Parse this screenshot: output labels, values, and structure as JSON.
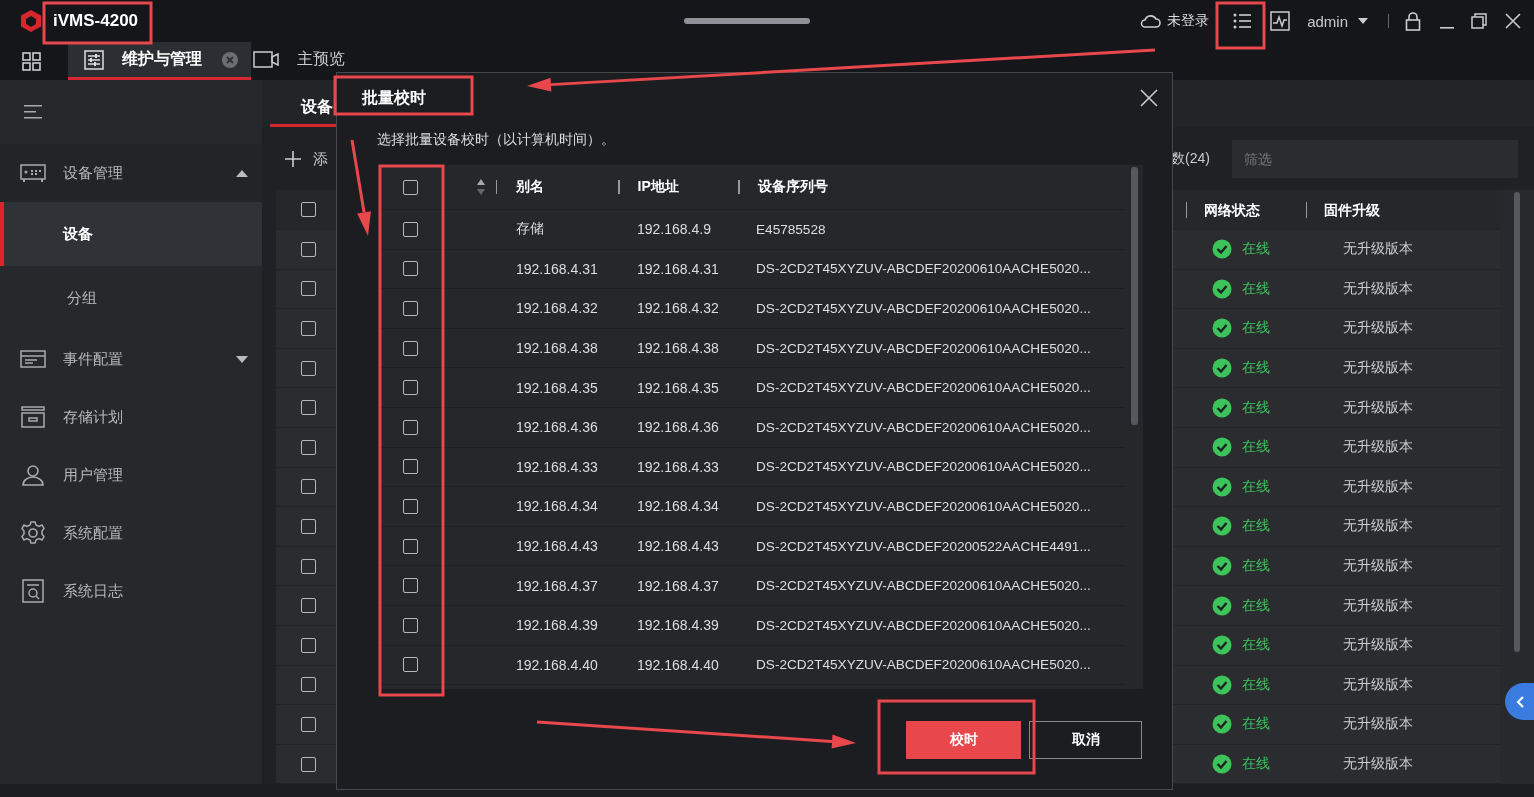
{
  "titlebar": {
    "app_name": "iVMS-4200",
    "login_status": "未登录",
    "user": "admin"
  },
  "tabs": [
    {
      "label": "维护与管理",
      "selected": true,
      "closable": true
    },
    {
      "label": "主预览",
      "selected": false,
      "closable": false
    }
  ],
  "sidebar": {
    "items": [
      {
        "label": "设备管理",
        "kind": "group",
        "expanded": true,
        "children": [
          {
            "label": "设备",
            "selected": true
          },
          {
            "label": "分组",
            "selected": false
          }
        ]
      },
      {
        "label": "事件配置",
        "kind": "group",
        "expanded": false
      },
      {
        "label": "存储计划",
        "kind": "item"
      },
      {
        "label": "用户管理",
        "kind": "item"
      },
      {
        "label": "系统配置",
        "kind": "item"
      },
      {
        "label": "系统日志",
        "kind": "item"
      }
    ]
  },
  "content": {
    "tabs": [
      {
        "label": "设备",
        "selected": true
      }
    ],
    "add_label": "添",
    "count_label": "数(24)",
    "filter": {
      "placeholder": "筛选"
    },
    "table": {
      "header_checked": false,
      "columns": [
        "网络状态",
        "固件升级"
      ],
      "rows": [
        {
          "checked": false,
          "online": true,
          "status": "在线",
          "firmware": "无升级版本"
        },
        {
          "checked": false,
          "online": true,
          "status": "在线",
          "firmware": "无升级版本"
        },
        {
          "checked": false,
          "online": true,
          "status": "在线",
          "firmware": "无升级版本"
        },
        {
          "checked": false,
          "online": true,
          "status": "在线",
          "firmware": "无升级版本"
        },
        {
          "checked": false,
          "online": true,
          "status": "在线",
          "firmware": "无升级版本"
        },
        {
          "checked": false,
          "online": true,
          "status": "在线",
          "firmware": "无升级版本"
        },
        {
          "checked": false,
          "online": true,
          "status": "在线",
          "firmware": "无升级版本"
        },
        {
          "checked": false,
          "online": true,
          "status": "在线",
          "firmware": "无升级版本"
        },
        {
          "checked": false,
          "online": true,
          "status": "在线",
          "firmware": "无升级版本"
        },
        {
          "checked": false,
          "online": true,
          "status": "在线",
          "firmware": "无升级版本"
        },
        {
          "checked": false,
          "online": true,
          "status": "在线",
          "firmware": "无升级版本"
        },
        {
          "checked": false,
          "online": true,
          "status": "在线",
          "firmware": "无升级版本"
        },
        {
          "checked": false,
          "online": true,
          "status": "在线",
          "firmware": "无升级版本"
        },
        {
          "checked": false,
          "online": true,
          "status": "在线",
          "firmware": "无升级版本"
        }
      ]
    }
  },
  "dialog": {
    "title": "批量校时",
    "instruction": "选择批量设备校时（以计算机时间）。",
    "table": {
      "header_checked": false,
      "columns": [
        "别名",
        "IP地址",
        "设备序列号"
      ],
      "rows": [
        {
          "checked": false,
          "alias": "存储",
          "ip": "192.168.4.9",
          "serial": "E45785528"
        },
        {
          "checked": false,
          "alias": "192.168.4.31",
          "ip": "192.168.4.31",
          "serial": "DS-2CD2T45XYZUV-ABCDEF20200610AACHE5020..."
        },
        {
          "checked": false,
          "alias": "192.168.4.32",
          "ip": "192.168.4.32",
          "serial": "DS-2CD2T45XYZUV-ABCDEF20200610AACHE5020..."
        },
        {
          "checked": false,
          "alias": "192.168.4.38",
          "ip": "192.168.4.38",
          "serial": "DS-2CD2T45XYZUV-ABCDEF20200610AACHE5020..."
        },
        {
          "checked": false,
          "alias": "192.168.4.35",
          "ip": "192.168.4.35",
          "serial": "DS-2CD2T45XYZUV-ABCDEF20200610AACHE5020..."
        },
        {
          "checked": false,
          "alias": "192.168.4.36",
          "ip": "192.168.4.36",
          "serial": "DS-2CD2T45XYZUV-ABCDEF20200610AACHE5020..."
        },
        {
          "checked": false,
          "alias": "192.168.4.33",
          "ip": "192.168.4.33",
          "serial": "DS-2CD2T45XYZUV-ABCDEF20200610AACHE5020..."
        },
        {
          "checked": false,
          "alias": "192.168.4.34",
          "ip": "192.168.4.34",
          "serial": "DS-2CD2T45XYZUV-ABCDEF20200610AACHE5020..."
        },
        {
          "checked": false,
          "alias": "192.168.4.43",
          "ip": "192.168.4.43",
          "serial": "DS-2CD2T45XYZUV-ABCDEF20200522AACHE4491..."
        },
        {
          "checked": false,
          "alias": "192.168.4.37",
          "ip": "192.168.4.37",
          "serial": "DS-2CD2T45XYZUV-ABCDEF20200610AACHE5020..."
        },
        {
          "checked": false,
          "alias": "192.168.4.39",
          "ip": "192.168.4.39",
          "serial": "DS-2CD2T45XYZUV-ABCDEF20200610AACHE5020..."
        },
        {
          "checked": false,
          "alias": "192.168.4.40",
          "ip": "192.168.4.40",
          "serial": "DS-2CD2T45XYZUV-ABCDEF20200610AACHE5020..."
        }
      ]
    },
    "buttons": [
      {
        "label": "校时",
        "kind": "primary"
      },
      {
        "label": "取消",
        "kind": "secondary"
      }
    ]
  }
}
